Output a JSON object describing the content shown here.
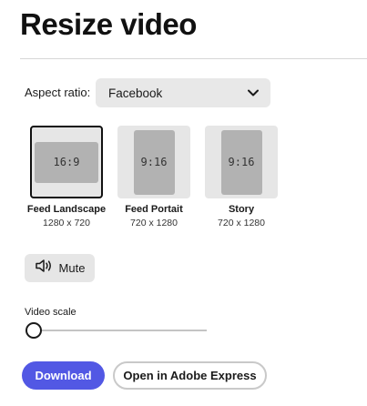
{
  "title": "Resize video",
  "aspect_ratio": {
    "label": "Aspect ratio:",
    "selected": "Facebook"
  },
  "presets": [
    {
      "name": "Feed Landscape",
      "size": "1280 x 720",
      "ratio": "16:9",
      "selected": true
    },
    {
      "name": "Feed Portait",
      "size": "720 x 1280",
      "ratio": "9:16",
      "selected": false
    },
    {
      "name": "Story",
      "size": "720 x 1280",
      "ratio": "9:16",
      "selected": false
    }
  ],
  "mute": {
    "label": "Mute",
    "icon": "speaker-icon"
  },
  "video_scale": {
    "label": "Video scale",
    "value": 0
  },
  "actions": {
    "download": "Download",
    "open_express": "Open in Adobe Express"
  },
  "colors": {
    "accent": "#5258e4",
    "tile_bg": "#e6e6e6",
    "frame": "#b2b2b2"
  }
}
